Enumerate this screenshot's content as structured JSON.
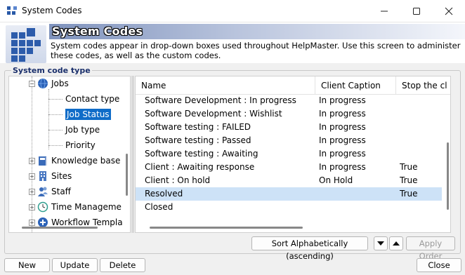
{
  "window": {
    "title": "System Codes",
    "icons": {
      "app": "app-logo-icon",
      "minimize": "minimize-icon",
      "maximize": "maximize-icon",
      "close": "close-icon"
    }
  },
  "header": {
    "title": "System Codes",
    "description": "System codes appear in drop-down boxes used throughout HelpMaster.  Use this screen to administer these codes, as well as the custom codes."
  },
  "group": {
    "label": "System code type"
  },
  "tree": {
    "items": [
      {
        "label": "Jobs",
        "icon": "globe-icon",
        "level": 0,
        "expanded": true
      },
      {
        "label": "Contact type",
        "level": 1
      },
      {
        "label": "Job Status",
        "level": 1,
        "selected": true
      },
      {
        "label": "Job type",
        "level": 1
      },
      {
        "label": "Priority",
        "level": 1
      },
      {
        "label": "Knowledge base",
        "icon": "book-icon",
        "level": 0
      },
      {
        "label": "Sites",
        "icon": "building-icon",
        "level": 0
      },
      {
        "label": "Staff",
        "icon": "people-icon",
        "level": 0
      },
      {
        "label": "Time Manageme",
        "icon": "clock-icon",
        "level": 0
      },
      {
        "label": "Workflow Templa",
        "icon": "workflow-icon",
        "level": 0
      }
    ]
  },
  "grid": {
    "columns": [
      "Name",
      "Client Caption",
      "Stop the cl"
    ],
    "rows": [
      {
        "name": "Software Development : In progress",
        "caption": "In progress",
        "stop": ""
      },
      {
        "name": "Software Development : Wishlist",
        "caption": "In progress",
        "stop": ""
      },
      {
        "name": "Software testing : FAILED",
        "caption": "In progress",
        "stop": ""
      },
      {
        "name": "Software testing : Passed",
        "caption": "In progress",
        "stop": ""
      },
      {
        "name": "Software testing : Awaiting",
        "caption": "In progress",
        "stop": ""
      },
      {
        "name": "Client : Awaiting response",
        "caption": "In progress",
        "stop": "True"
      },
      {
        "name": "Client : On hold",
        "caption": "On Hold",
        "stop": "True"
      },
      {
        "name": "Resolved",
        "caption": "",
        "stop": "True",
        "selected": true
      },
      {
        "name": "Closed",
        "caption": "",
        "stop": ""
      }
    ]
  },
  "sort_bar": {
    "sort_label": "Sort Alphabetically (ascending)",
    "move_down_icon": "triangle-down-icon",
    "move_up_icon": "triangle-up-icon",
    "apply_label": "Apply Order"
  },
  "footer": {
    "new_label": "New",
    "update_label": "Update",
    "delete_label": "Delete",
    "close_label": "Close"
  }
}
